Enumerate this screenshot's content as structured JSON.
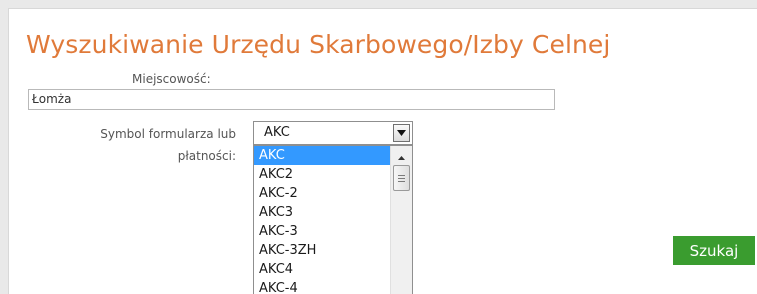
{
  "form": {
    "title": "Wyszukiwanie Urzędu Skarbowego/Izby Celnej",
    "city_label": "Miejscowość:",
    "city_value": "Łomża",
    "symbol_label": "Symbol formularza lub płatności:",
    "symbol_selected": "AKC",
    "symbol_options": [
      "AKC",
      "AKC2",
      "AKC-2",
      "AKC3",
      "AKC-3",
      "AKC-3ZH",
      "AKC4",
      "AKC-4"
    ],
    "search_button": "Szukaj"
  },
  "colors": {
    "title": "#e07a3a",
    "selected_option": "#3399ff",
    "button": "#3a9c2f"
  },
  "icons": {
    "dropdown_arrow": "chevron-down-icon",
    "scroll_up": "arrow-up-icon",
    "scroll_thumb": "scroll-grip-icon"
  }
}
